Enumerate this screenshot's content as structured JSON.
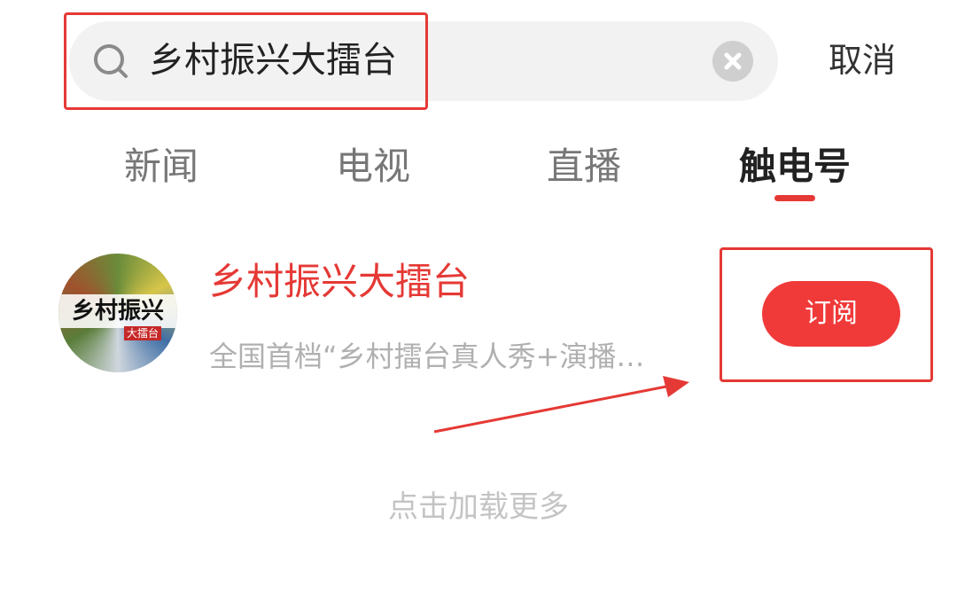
{
  "search": {
    "query": "乡村振兴大擂台",
    "cancel_label": "取消",
    "icon": "search-icon",
    "clear_icon": "clear-icon"
  },
  "tabs": [
    {
      "label": "新闻",
      "active": false
    },
    {
      "label": "电视",
      "active": false
    },
    {
      "label": "直播",
      "active": false
    },
    {
      "label": "触电号",
      "active": true
    }
  ],
  "results": [
    {
      "avatar_text": "乡村振兴",
      "avatar_subtext": "大擂台",
      "title": "乡村振兴大擂台",
      "description": "全国首档“乡村擂台真人秀+演播…",
      "subscribe_label": "订阅"
    }
  ],
  "load_more_label": "点击加载更多",
  "colors": {
    "accent": "#e53935",
    "subscribe_bg": "#f03a3a",
    "annotation": "#e53935"
  }
}
